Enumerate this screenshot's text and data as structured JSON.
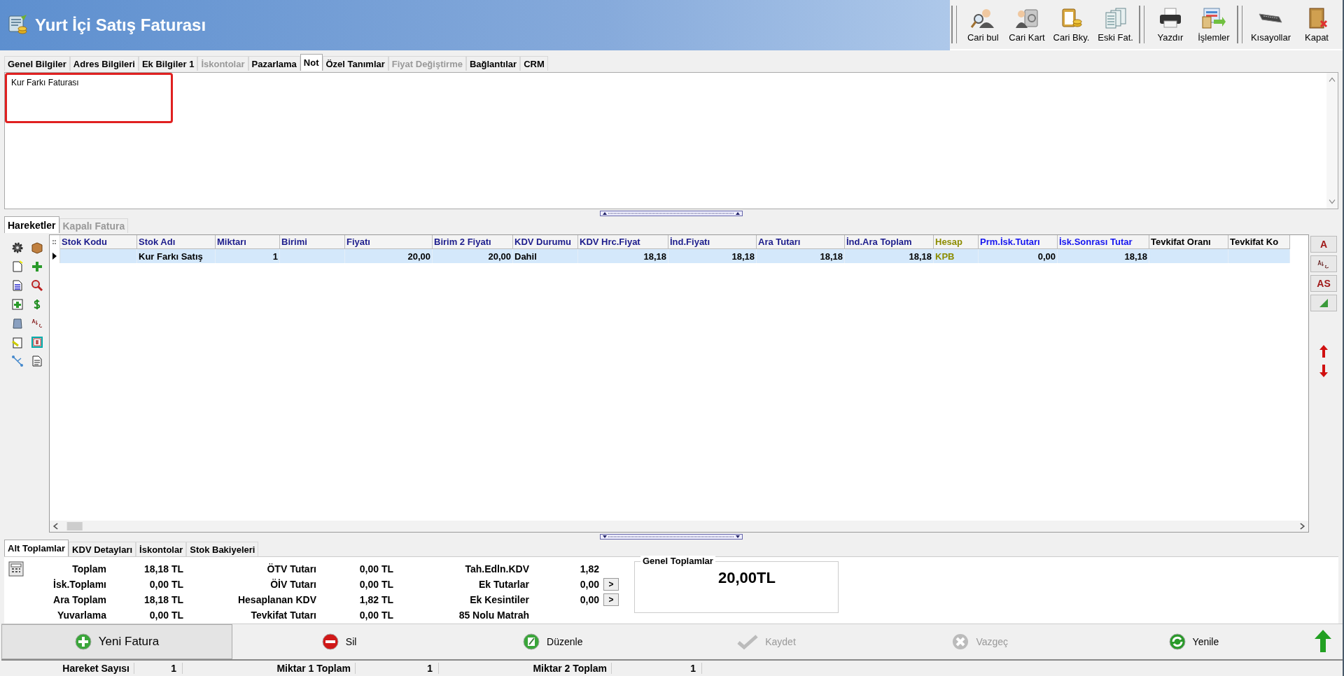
{
  "window": {
    "title": "Yurt İçi Satış Faturası"
  },
  "toolbar": {
    "groups": [
      {
        "buttons": [
          {
            "kind": "find-person",
            "label": "Cari bul"
          },
          {
            "kind": "person-card",
            "label": "Cari Kart"
          },
          {
            "kind": "clipboard-coins",
            "label": "Cari Bky."
          },
          {
            "kind": "documents",
            "label": "Eski Fat."
          }
        ]
      },
      {
        "buttons": [
          {
            "kind": "printer",
            "label": "Yazdır"
          },
          {
            "kind": "forms",
            "label": "İşlemler"
          }
        ]
      },
      {
        "buttons": [
          {
            "kind": "keyboard",
            "label": "Kısayollar"
          },
          {
            "kind": "door",
            "label": "Kapat"
          }
        ]
      }
    ]
  },
  "tabs": [
    {
      "label": "Genel Bilgiler",
      "selected": false,
      "disabled": false
    },
    {
      "label": "Adres Bilgileri",
      "selected": false,
      "disabled": false
    },
    {
      "label": "Ek Bilgiler 1",
      "selected": false,
      "disabled": false
    },
    {
      "label": "İskontolar",
      "selected": false,
      "disabled": true
    },
    {
      "label": "Pazarlama",
      "selected": false,
      "disabled": false
    },
    {
      "label": "Not",
      "selected": true,
      "disabled": false
    },
    {
      "label": "Özel Tanımlar",
      "selected": false,
      "disabled": false
    },
    {
      "label": "Fiyat Değiştirme",
      "selected": false,
      "disabled": true
    },
    {
      "label": "Bağlantılar",
      "selected": false,
      "disabled": false
    },
    {
      "label": "CRM",
      "selected": false,
      "disabled": false
    }
  ],
  "note": {
    "value": "Kur Farkı Faturası",
    "highlighted": true
  },
  "detail_tabs": [
    {
      "label": "Hareketler",
      "selected": true,
      "disabled": false
    },
    {
      "label": "Kapalı Fatura",
      "selected": false,
      "disabled": true
    }
  ],
  "grid": {
    "columns": [
      {
        "label": "Stok Kodu",
        "kind": "text",
        "color": "#1c1c8c"
      },
      {
        "label": "Stok Adı",
        "kind": "text",
        "color": "#1c1c8c",
        "tint_cells": false
      },
      {
        "label": "Miktarı",
        "kind": "number",
        "color": "#1c1c8c",
        "tint_cells": false
      },
      {
        "label": "Birimi",
        "kind": "text",
        "color": "#1c1c8c"
      },
      {
        "label": "Fiyatı",
        "kind": "number",
        "color": "#1c1c8c",
        "tint_cells": false
      },
      {
        "label": "Birim 2 Fiyatı",
        "kind": "number",
        "color": "#1c1c8c",
        "tint_cells": false
      },
      {
        "label": "KDV Durumu",
        "kind": "text",
        "color": "#1c1c8c",
        "tint_cells": false
      },
      {
        "label": "KDV Hrc.Fiyat",
        "kind": "number",
        "color": "#1c1c8c",
        "tint_cells": false
      },
      {
        "label": "İnd.Fiyatı",
        "kind": "number",
        "color": "#1c1c8c",
        "tint_cells": false
      },
      {
        "label": "Ara Tutarı",
        "kind": "number",
        "color": "#1c1c8c",
        "tint_cells": false
      },
      {
        "label": "İnd.Ara Toplam",
        "kind": "number",
        "color": "#1c1c8c",
        "tint_cells": false
      },
      {
        "label": "Hesap",
        "kind": "text",
        "color": "#8c8c00",
        "tint_cells": true
      },
      {
        "label": "Prm.İsk.Tutarı",
        "kind": "number",
        "color": "#1414f0",
        "tint_cells": false
      },
      {
        "label": "İsk.Sonrası Tutar",
        "kind": "number",
        "color": "#1414f0",
        "tint_cells": false
      },
      {
        "label": "Tevkifat Oranı",
        "kind": "text",
        "color": "#000000"
      },
      {
        "label": "Tevkifat Ko",
        "kind": "text",
        "color": "#000000"
      }
    ],
    "rows": [
      {
        "selected": true,
        "cells": [
          null,
          "Kur Farkı Satış",
          "1",
          null,
          "20,00",
          "20,00",
          "Dahil",
          "18,18",
          "18,18",
          "18,18",
          "18,18",
          "KPB",
          "0,00",
          "18,18",
          null,
          null
        ]
      }
    ]
  },
  "side_tools": [
    {
      "kind": "text",
      "label": "A"
    },
    {
      "kind": "abc"
    },
    {
      "kind": "text",
      "label": "AS"
    },
    {
      "kind": "triangle"
    }
  ],
  "totals_tabs": [
    {
      "label": "Alt Toplamlar",
      "selected": true
    },
    {
      "label": "KDV Detayları",
      "selected": false
    },
    {
      "label": "İskontolar",
      "selected": false
    },
    {
      "label": "Stok Bakiyeleri",
      "selected": false
    }
  ],
  "totals": {
    "columns": [
      {
        "rows": [
          {
            "label": "Toplam",
            "value": "18,18 TL"
          },
          {
            "label": "İsk.Toplamı",
            "value": "0,00 TL"
          },
          {
            "label": "Ara Toplam",
            "value": "18,18 TL"
          },
          {
            "label": "Yuvarlama",
            "value": "0,00 TL"
          }
        ]
      },
      {
        "rows": [
          {
            "label": "ÖTV Tutarı",
            "value": "0,00 TL"
          },
          {
            "label": "ÖİV Tutarı",
            "value": "0,00 TL"
          },
          {
            "label": "Hesaplanan KDV",
            "value": "1,82 TL"
          },
          {
            "label": "Tevkifat Tutarı",
            "value": "0,00 TL"
          }
        ]
      },
      {
        "rows": [
          {
            "label": "Tah.Edln.KDV",
            "value": "1,82"
          },
          {
            "label": "Ek Tutarlar",
            "value": "0,00",
            "button": ">"
          },
          {
            "label": "Ek Kesintiler",
            "value": "0,00",
            "button": ">"
          },
          {
            "label": "85 Nolu Matrah"
          }
        ]
      }
    ]
  },
  "grand_total": {
    "title": "Genel Toplamlar",
    "value": "20,00TL"
  },
  "actions": [
    {
      "kind": "add",
      "label": "Yeni Fatura",
      "disabled": false,
      "focused": true
    },
    {
      "kind": "delete",
      "label": "Sil",
      "disabled": false,
      "focused": false
    },
    {
      "kind": "edit",
      "label": "Düzenle",
      "disabled": false,
      "focused": false
    },
    {
      "kind": "save",
      "label": "Kaydet",
      "disabled": true,
      "focused": false
    },
    {
      "kind": "cancel",
      "label": "Vazgeç",
      "disabled": true,
      "focused": false
    },
    {
      "kind": "refresh",
      "label": "Yenile",
      "disabled": false,
      "focused": false
    }
  ],
  "status_bar": [
    {
      "label": "Hareket Sayısı",
      "value": "1"
    },
    {
      "label": "Miktar 1 Toplam",
      "value": "1"
    },
    {
      "label": "Miktar 2 Toplam",
      "value": "1"
    }
  ]
}
